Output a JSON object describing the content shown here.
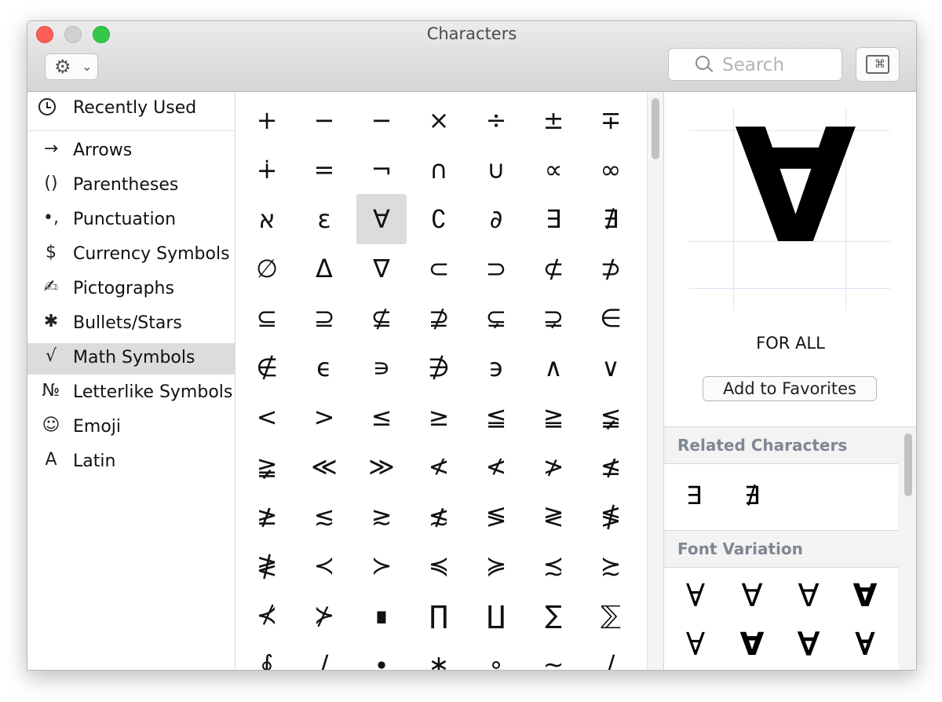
{
  "window": {
    "title": "Characters"
  },
  "toolbar": {
    "gear_icon": "⚙",
    "chevron_icon": "⌄",
    "search_placeholder": "Search",
    "keyboard_icon": "⌘"
  },
  "sidebar": {
    "recent": {
      "label": "Recently Used",
      "icon": "clock-icon"
    },
    "items": [
      {
        "icon": "→",
        "label": "Arrows"
      },
      {
        "icon": "()",
        "label": "Parentheses"
      },
      {
        "icon": "•,",
        "label": "Punctuation"
      },
      {
        "icon": "$",
        "label": "Currency Symbols"
      },
      {
        "icon": "✍",
        "label": "Pictographs"
      },
      {
        "icon": "✱",
        "label": "Bullets/Stars"
      },
      {
        "icon": "√",
        "label": "Math Symbols"
      },
      {
        "icon": "№",
        "label": "Letterlike Symbols"
      },
      {
        "icon": "☺",
        "label": "Emoji"
      },
      {
        "icon": "A",
        "label": "Latin"
      }
    ],
    "selected": "Math Symbols"
  },
  "grid": {
    "rows": [
      [
        "+",
        "−",
        "−",
        "×",
        "÷",
        "±",
        "∓"
      ],
      [
        "∔",
        "=",
        "¬",
        "∩",
        "∪",
        "∝",
        "∞"
      ],
      [
        "א",
        "ε",
        "∀",
        "∁",
        "∂",
        "∃",
        "∄"
      ],
      [
        "∅",
        "Δ",
        "∇",
        "⊂",
        "⊃",
        "⊄",
        "⊅"
      ],
      [
        "⊆",
        "⊇",
        "⊈",
        "⊉",
        "⊊",
        "⊋",
        "∈"
      ],
      [
        "∉",
        "ϵ",
        "∍",
        "∌",
        "϶",
        "∧",
        "∨"
      ],
      [
        "<",
        ">",
        "≤",
        "≥",
        "≦",
        "≧",
        "≨"
      ],
      [
        "≩",
        "≪",
        "≫",
        "≮",
        "≮",
        "≯",
        "≰"
      ],
      [
        "≱",
        "≲",
        "≳",
        "≴",
        "≶",
        "≷",
        "≸"
      ],
      [
        "≹",
        "≺",
        "≻",
        "≼",
        "≽",
        "≾",
        "≿"
      ],
      [
        "⊀",
        "⊁",
        "∎",
        "∏",
        "∐",
        "∑",
        "⅀"
      ],
      [
        "∮",
        "∕",
        "∙",
        "∗",
        "∘",
        "∼",
        "∕"
      ]
    ],
    "selected": "∀"
  },
  "detail": {
    "char": "∀",
    "name": "FOR ALL",
    "add_favorites": "Add to Favorites",
    "related_heading": "Related Characters",
    "related": [
      "∃",
      "∄"
    ],
    "font_heading": "Font Variation",
    "font_variations": [
      "∀",
      "∀",
      "∀",
      "∀",
      "∀",
      "∀",
      "∀",
      "∀"
    ]
  }
}
